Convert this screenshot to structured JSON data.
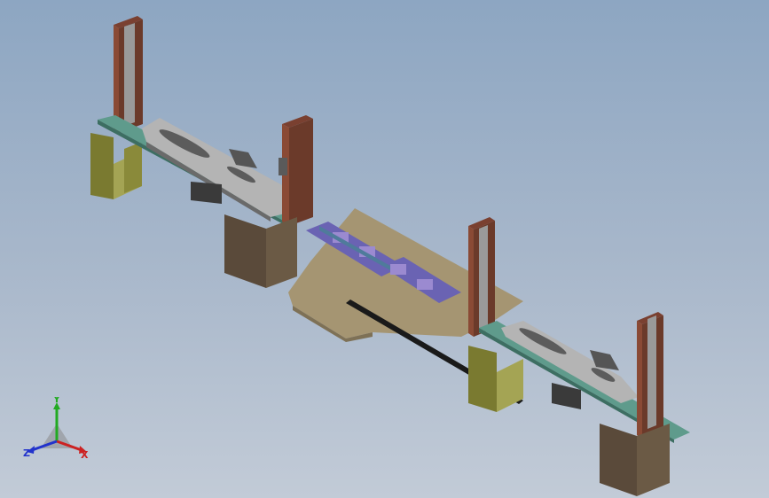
{
  "viewport": {
    "background_top": "#8da6c2",
    "background_bottom": "#c2cbd7"
  },
  "model": {
    "description_colors": {
      "brown_plate": "#5a4a3a",
      "olive_plate": "#6b6a2a",
      "beige_base": "#a59572",
      "teal_rail": "#5f9b8c",
      "gray_steel": "#8b8b8b",
      "purple_block": "#6a63b3",
      "dark_post": "#6b3a2a"
    }
  },
  "triad": {
    "y_label": "Y",
    "x_label": "X",
    "z_label": "Z",
    "y_color": "#22aa22",
    "x_color": "#cc2222",
    "z_color": "#2233cc"
  }
}
